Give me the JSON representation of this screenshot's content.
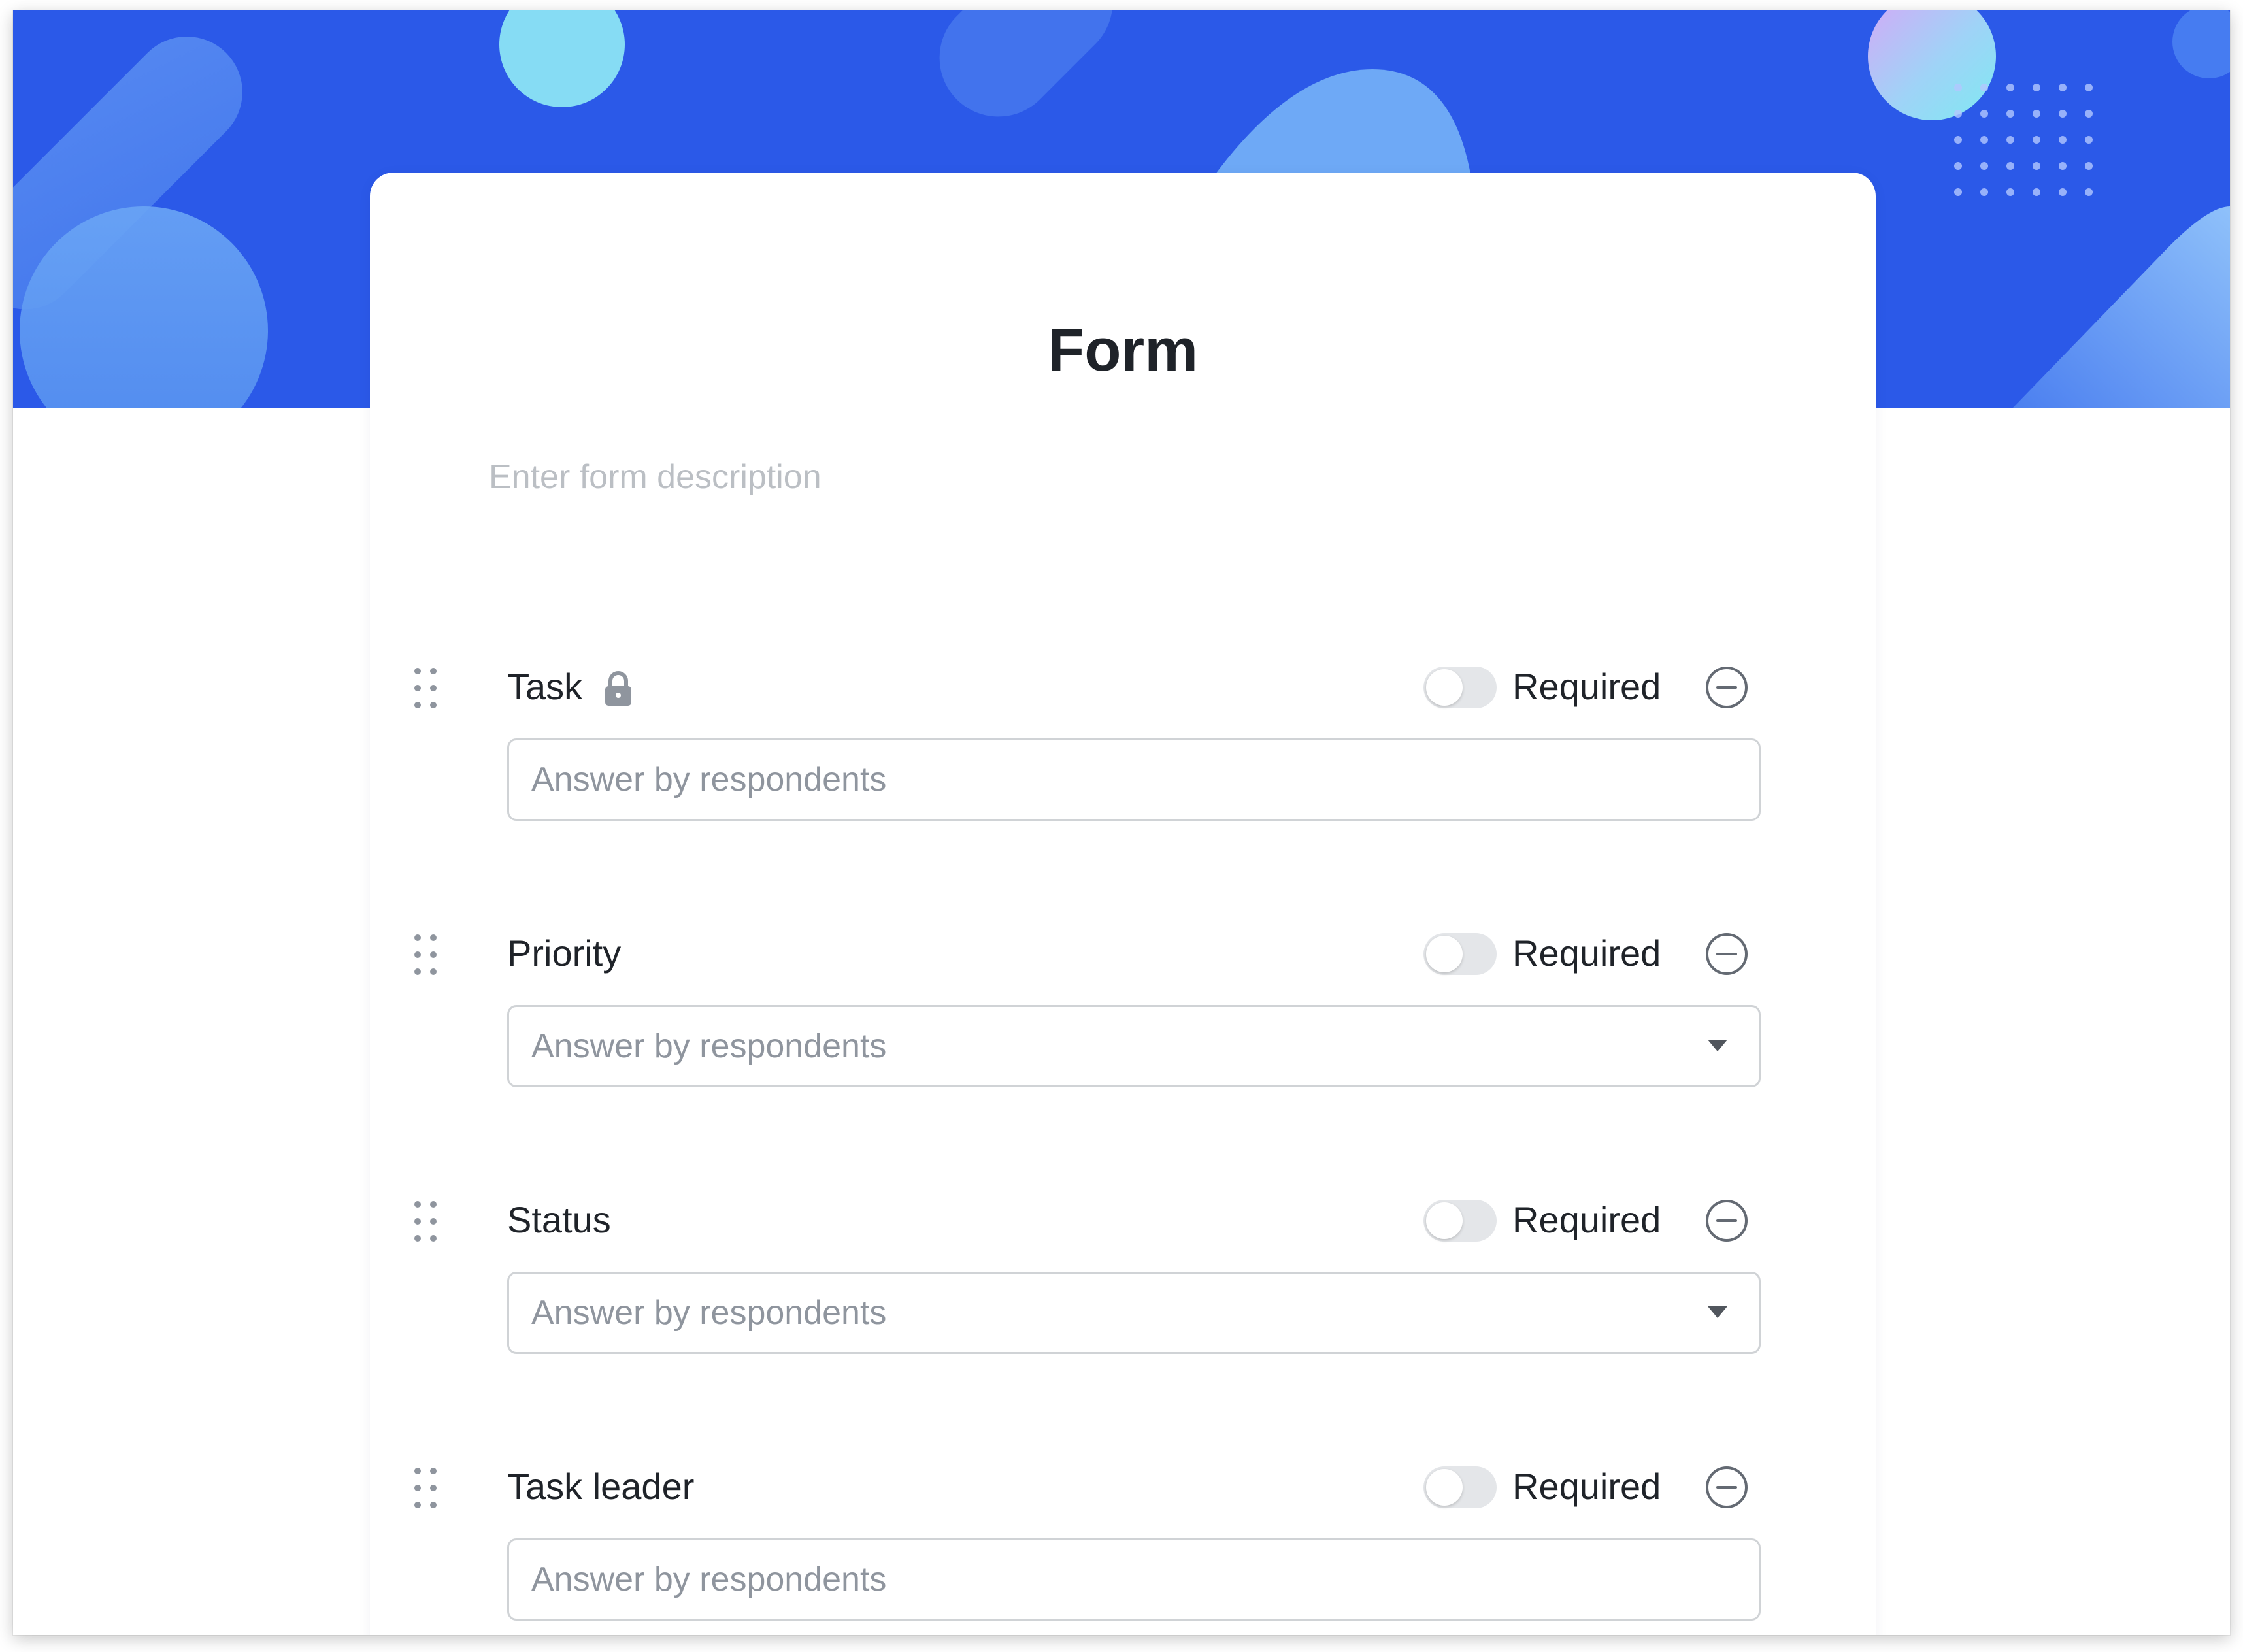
{
  "form": {
    "title": "Form",
    "description_placeholder": "Enter form description"
  },
  "fields": [
    {
      "label": "Task",
      "locked": true,
      "type": "text",
      "required_label": "Required",
      "required": false,
      "answer_placeholder": "Answer by respondents"
    },
    {
      "label": "Priority",
      "locked": false,
      "type": "select",
      "required_label": "Required",
      "required": false,
      "answer_placeholder": "Answer by respondents"
    },
    {
      "label": "Status",
      "locked": false,
      "type": "select",
      "required_label": "Required",
      "required": false,
      "answer_placeholder": "Answer by respondents"
    },
    {
      "label": "Task leader",
      "locked": false,
      "type": "text",
      "required_label": "Required",
      "required": false,
      "answer_placeholder": "Answer by respondents"
    }
  ],
  "icons": {
    "drag": "drag-handle-icon",
    "lock": "lock-icon",
    "remove": "remove-circle-icon",
    "dropdown": "chevron-down-icon"
  },
  "colors": {
    "banner": "#2b59e8",
    "toggle_off": "#e4e6e9",
    "text_primary": "#1f2329",
    "text_placeholder": "#8f959e"
  }
}
